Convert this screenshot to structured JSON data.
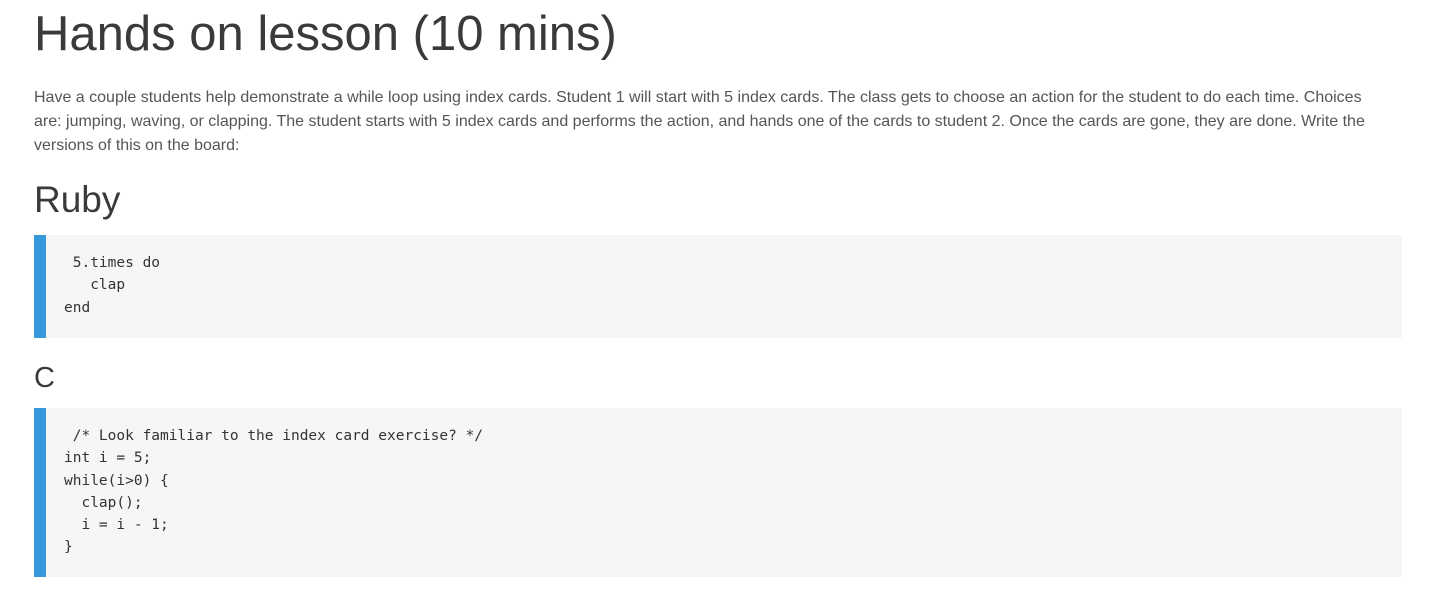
{
  "lesson": {
    "title": "Hands on lesson (10 mins)",
    "intro": "Have a couple students help demonstrate a while loop using index cards. Student 1 will start with 5 index cards. The class gets to choose an action for the student to do each time. Choices are: jumping, waving, or clapping. The student starts with 5 index cards and performs the action, and hands one of the cards to student 2. Once the cards are gone, they are done. Write the versions of this on the board:"
  },
  "sections": {
    "ruby": {
      "heading": "Ruby",
      "code": " 5.times do\n   clap\nend"
    },
    "c": {
      "heading": "C",
      "code": " /* Look familiar to the index card exercise? */\nint i = 5;\nwhile(i>0) {\n  clap();\n  i = i - 1;\n}"
    }
  },
  "colors": {
    "accent_bar": "#3498db",
    "code_background": "#f6f6f8",
    "heading_text": "#3a3a3a",
    "body_text": "#555555"
  }
}
